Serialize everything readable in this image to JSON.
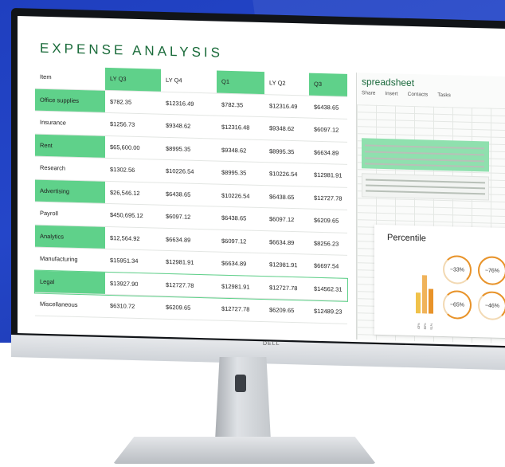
{
  "expense": {
    "title": "EXPENSE ANALYSIS",
    "headers": [
      "Item",
      "LY Q3",
      "LY Q4",
      "Q1",
      "LY Q2",
      "Q3"
    ],
    "rows": [
      [
        "Office supplies",
        "$782.35",
        "$12316.49",
        "$782.35",
        "$12316.49",
        "$6438.65"
      ],
      [
        "Insurance",
        "$1256.73",
        "$9348.62",
        "$12316.48",
        "$9348.62",
        "$6097.12"
      ],
      [
        "Rent",
        "$65,600.00",
        "$8995.35",
        "$9348.62",
        "$8995.35",
        "$6634.89"
      ],
      [
        "Research",
        "$1302.56",
        "$10226.54",
        "$8995.35",
        "$10226.54",
        "$12981.91"
      ],
      [
        "Advertising",
        "$26,546.12",
        "$6438.65",
        "$10226.54",
        "$6438.65",
        "$12727.78"
      ],
      [
        "Payroll",
        "$450,695.12",
        "$6097.12",
        "$6438.65",
        "$6097.12",
        "$6209.65"
      ],
      [
        "Analytics",
        "$12,564.92",
        "$6634.89",
        "$6097.12",
        "$6634.89",
        "$8256.23"
      ],
      [
        "Manufacturing",
        "$15951.34",
        "$12981.91",
        "$6634.89",
        "$12981.91",
        "$6697.54"
      ],
      [
        "Legal",
        "$13927.90",
        "$12727.78",
        "$12981.91",
        "$12727.78",
        "$14562.31"
      ],
      [
        "Miscellaneous",
        "$6310.72",
        "$6209.65",
        "$12727.78",
        "$6209.65",
        "$12489.23"
      ]
    ]
  },
  "spreadsheet": {
    "title": "spreadsheet",
    "tabs": [
      "Share",
      "Insert",
      "Contacts",
      "Tasks"
    ]
  },
  "percentile": {
    "title": "Percentile",
    "bars": [
      {
        "label": "43%",
        "value": 0.43
      },
      {
        "label": "80%",
        "value": 0.8
      },
      {
        "label": "51%",
        "value": 0.51
      }
    ],
    "rings": [
      {
        "label": "−33%",
        "value": 0.33
      },
      {
        "label": "−76%",
        "value": 0.76
      },
      {
        "label": "−65%",
        "value": 0.65
      },
      {
        "label": "−46%",
        "value": 0.46
      }
    ],
    "accent": "#e8932a",
    "bar_colors": [
      "#f0c24a",
      "#f0b35a",
      "#e8932a"
    ]
  },
  "monitor": {
    "brand": "DELL"
  },
  "colors": {
    "highlight": "#5fd18a",
    "title": "#1a6b3a",
    "background": "#2446c9"
  }
}
